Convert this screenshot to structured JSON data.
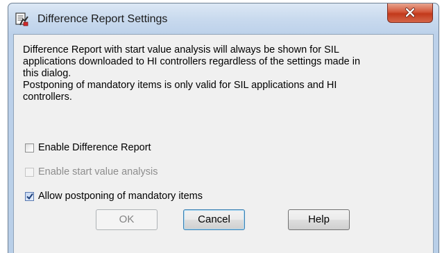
{
  "window": {
    "title": "Difference Report Settings",
    "title_icon": "settings-report-icon",
    "close_label": "close"
  },
  "info": {
    "lines": [
      "Difference Report with start value analysis will always be shown for SIL",
      "applications downloaded to HI controllers regardless of the settings made in",
      "this dialog.",
      "Postponing of mandatory items is only valid for SIL applications and HI",
      "controllers."
    ]
  },
  "options": {
    "enable_difference_report": {
      "label": "Enable Difference Report",
      "checked": false,
      "enabled": true
    },
    "enable_start_value_analysis": {
      "label": "Enable start value analysis",
      "checked": false,
      "enabled": false
    },
    "allow_postponing": {
      "label": "Allow postponing of mandatory items",
      "checked": true,
      "enabled": true
    }
  },
  "buttons": {
    "ok": {
      "label": "OK",
      "enabled": false
    },
    "cancel": {
      "label": "Cancel",
      "enabled": true
    },
    "help": {
      "label": "Help",
      "enabled": true
    }
  },
  "colors": {
    "title_bar": "#bcd1ea",
    "close_button": "#c2391b",
    "dialog_background": "#f0f0f0",
    "default_button_border": "#3c7fb1"
  }
}
